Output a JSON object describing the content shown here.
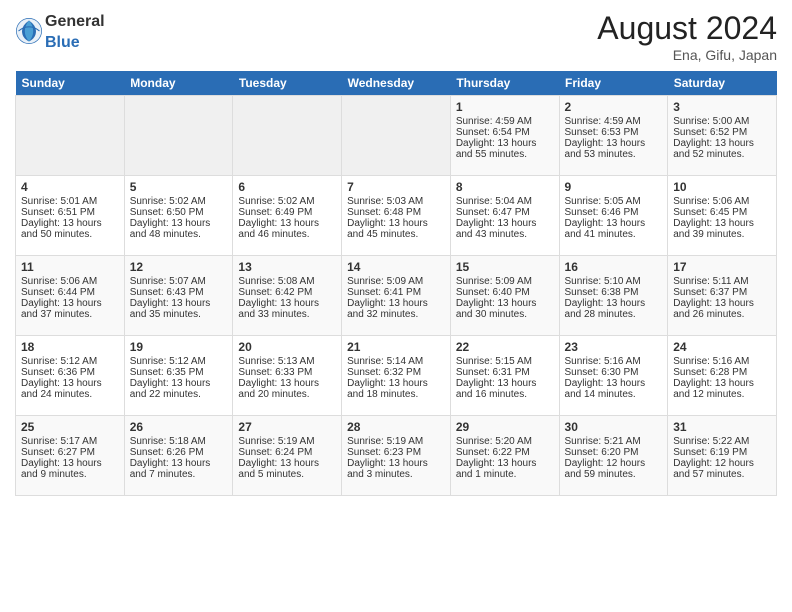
{
  "header": {
    "logo_general": "General",
    "logo_blue": "Blue",
    "title": "August 2024",
    "location": "Ena, Gifu, Japan"
  },
  "days_of_week": [
    "Sunday",
    "Monday",
    "Tuesday",
    "Wednesday",
    "Thursday",
    "Friday",
    "Saturday"
  ],
  "weeks": [
    [
      {
        "day": "",
        "info": ""
      },
      {
        "day": "",
        "info": ""
      },
      {
        "day": "",
        "info": ""
      },
      {
        "day": "",
        "info": ""
      },
      {
        "day": "1",
        "sunrise": "4:59 AM",
        "sunset": "6:54 PM",
        "daylight": "13 hours and 55 minutes."
      },
      {
        "day": "2",
        "sunrise": "4:59 AM",
        "sunset": "6:53 PM",
        "daylight": "13 hours and 53 minutes."
      },
      {
        "day": "3",
        "sunrise": "5:00 AM",
        "sunset": "6:52 PM",
        "daylight": "13 hours and 52 minutes."
      }
    ],
    [
      {
        "day": "4",
        "sunrise": "5:01 AM",
        "sunset": "6:51 PM",
        "daylight": "13 hours and 50 minutes."
      },
      {
        "day": "5",
        "sunrise": "5:02 AM",
        "sunset": "6:50 PM",
        "daylight": "13 hours and 48 minutes."
      },
      {
        "day": "6",
        "sunrise": "5:02 AM",
        "sunset": "6:49 PM",
        "daylight": "13 hours and 46 minutes."
      },
      {
        "day": "7",
        "sunrise": "5:03 AM",
        "sunset": "6:48 PM",
        "daylight": "13 hours and 45 minutes."
      },
      {
        "day": "8",
        "sunrise": "5:04 AM",
        "sunset": "6:47 PM",
        "daylight": "13 hours and 43 minutes."
      },
      {
        "day": "9",
        "sunrise": "5:05 AM",
        "sunset": "6:46 PM",
        "daylight": "13 hours and 41 minutes."
      },
      {
        "day": "10",
        "sunrise": "5:06 AM",
        "sunset": "6:45 PM",
        "daylight": "13 hours and 39 minutes."
      }
    ],
    [
      {
        "day": "11",
        "sunrise": "5:06 AM",
        "sunset": "6:44 PM",
        "daylight": "13 hours and 37 minutes."
      },
      {
        "day": "12",
        "sunrise": "5:07 AM",
        "sunset": "6:43 PM",
        "daylight": "13 hours and 35 minutes."
      },
      {
        "day": "13",
        "sunrise": "5:08 AM",
        "sunset": "6:42 PM",
        "daylight": "13 hours and 33 minutes."
      },
      {
        "day": "14",
        "sunrise": "5:09 AM",
        "sunset": "6:41 PM",
        "daylight": "13 hours and 32 minutes."
      },
      {
        "day": "15",
        "sunrise": "5:09 AM",
        "sunset": "6:40 PM",
        "daylight": "13 hours and 30 minutes."
      },
      {
        "day": "16",
        "sunrise": "5:10 AM",
        "sunset": "6:38 PM",
        "daylight": "13 hours and 28 minutes."
      },
      {
        "day": "17",
        "sunrise": "5:11 AM",
        "sunset": "6:37 PM",
        "daylight": "13 hours and 26 minutes."
      }
    ],
    [
      {
        "day": "18",
        "sunrise": "5:12 AM",
        "sunset": "6:36 PM",
        "daylight": "13 hours and 24 minutes."
      },
      {
        "day": "19",
        "sunrise": "5:12 AM",
        "sunset": "6:35 PM",
        "daylight": "13 hours and 22 minutes."
      },
      {
        "day": "20",
        "sunrise": "5:13 AM",
        "sunset": "6:33 PM",
        "daylight": "13 hours and 20 minutes."
      },
      {
        "day": "21",
        "sunrise": "5:14 AM",
        "sunset": "6:32 PM",
        "daylight": "13 hours and 18 minutes."
      },
      {
        "day": "22",
        "sunrise": "5:15 AM",
        "sunset": "6:31 PM",
        "daylight": "13 hours and 16 minutes."
      },
      {
        "day": "23",
        "sunrise": "5:16 AM",
        "sunset": "6:30 PM",
        "daylight": "13 hours and 14 minutes."
      },
      {
        "day": "24",
        "sunrise": "5:16 AM",
        "sunset": "6:28 PM",
        "daylight": "13 hours and 12 minutes."
      }
    ],
    [
      {
        "day": "25",
        "sunrise": "5:17 AM",
        "sunset": "6:27 PM",
        "daylight": "13 hours and 9 minutes."
      },
      {
        "day": "26",
        "sunrise": "5:18 AM",
        "sunset": "6:26 PM",
        "daylight": "13 hours and 7 minutes."
      },
      {
        "day": "27",
        "sunrise": "5:19 AM",
        "sunset": "6:24 PM",
        "daylight": "13 hours and 5 minutes."
      },
      {
        "day": "28",
        "sunrise": "5:19 AM",
        "sunset": "6:23 PM",
        "daylight": "13 hours and 3 minutes."
      },
      {
        "day": "29",
        "sunrise": "5:20 AM",
        "sunset": "6:22 PM",
        "daylight": "13 hours and 1 minute."
      },
      {
        "day": "30",
        "sunrise": "5:21 AM",
        "sunset": "6:20 PM",
        "daylight": "12 hours and 59 minutes."
      },
      {
        "day": "31",
        "sunrise": "5:22 AM",
        "sunset": "6:19 PM",
        "daylight": "12 hours and 57 minutes."
      }
    ]
  ]
}
